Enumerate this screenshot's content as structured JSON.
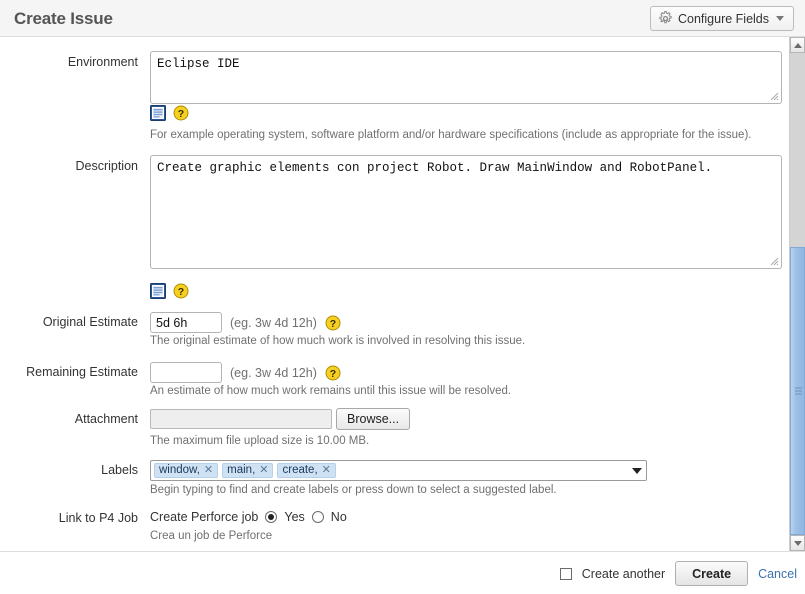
{
  "header": {
    "title": "Create Issue",
    "configure_fields_label": "Configure Fields",
    "gear_icon": "gear-icon",
    "caret_icon": "chevron-down-icon"
  },
  "form": {
    "environment": {
      "label": "Environment",
      "value": "Eclipse IDE",
      "wiki_icon": "wiki-renderer-icon",
      "help_icon": "help-icon",
      "hint": "For example operating system, software platform and/or hardware specifications (include as appropriate for the issue)."
    },
    "description": {
      "label": "Description",
      "value": "Create graphic elements con project Robot. Draw MainWindow and RobotPanel.",
      "wiki_icon": "wiki-renderer-icon",
      "help_icon": "help-icon"
    },
    "original_estimate": {
      "label": "Original Estimate",
      "value": "5d 6h",
      "placeholder": "",
      "example": "(eg. 3w 4d 12h)",
      "help_icon": "help-icon",
      "hint": "The original estimate of how much work is involved in resolving this issue."
    },
    "remaining_estimate": {
      "label": "Remaining Estimate",
      "value": "",
      "placeholder": "",
      "example": "(eg. 3w 4d 12h)",
      "help_icon": "help-icon",
      "hint": "An estimate of how much work remains until this issue will be resolved."
    },
    "attachment": {
      "label": "Attachment",
      "value": "",
      "browse_label": "Browse...",
      "hint": "The maximum file upload size is 10.00 MB."
    },
    "labels": {
      "label": "Labels",
      "chips": [
        {
          "text": "window,",
          "remove_icon": "close-icon"
        },
        {
          "text": "main,",
          "remove_icon": "close-icon"
        },
        {
          "text": "create,",
          "remove_icon": "close-icon"
        }
      ],
      "caret_icon": "chevron-down-icon",
      "hint": "Begin typing to find and create labels or press down to select a suggested label."
    },
    "link_to_p4_job": {
      "label": "Link to P4 Job",
      "question": "Create Perforce job",
      "yes_label": "Yes",
      "no_label": "No",
      "selected": "Yes",
      "hint": "Crea un job de Perforce"
    }
  },
  "scrollbar": {
    "up_icon": "scroll-up-arrow-icon",
    "down_icon": "scroll-down-arrow-icon",
    "thumb_color": "#9dc0e6"
  },
  "footer": {
    "create_another_label": "Create another",
    "create_another_checked": false,
    "create_label": "Create",
    "cancel_label": "Cancel",
    "link_color": "#3b73af"
  }
}
